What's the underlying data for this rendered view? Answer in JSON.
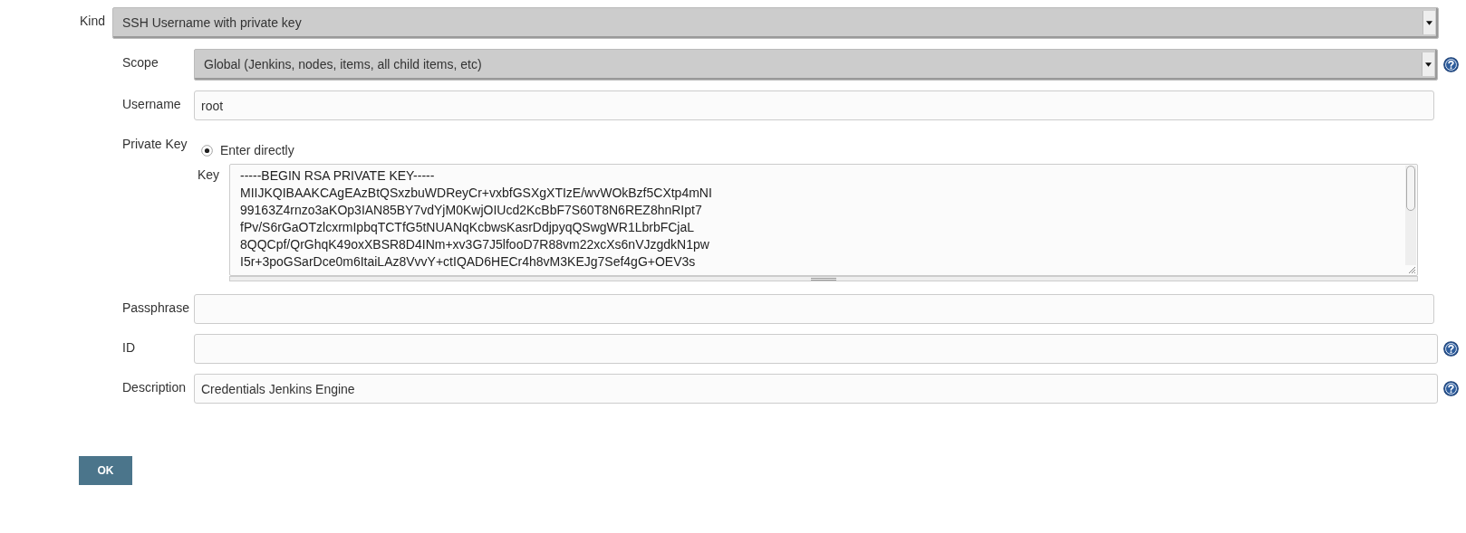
{
  "kind": {
    "label": "Kind",
    "value": "SSH Username with private key"
  },
  "fields": [
    {
      "kind": "select",
      "label": "Scope",
      "value": "Global (Jenkins, nodes, items, all child items, etc)",
      "help": true
    },
    {
      "kind": "text",
      "label": "Username",
      "value": "root",
      "help": false
    },
    {
      "kind": "private_key",
      "label": "Private Key",
      "options": [
        {
          "label": "Enter directly",
          "selected": true
        }
      ],
      "key_label": "Key",
      "key_lines": [
        "-----BEGIN RSA PRIVATE KEY-----",
        "MIIJKQIBAAKCAgEAzBtQSxzbuWDReyCr+vxbfGSXgXTIzE/wvWOkBzf5CXtp4mNI",
        "99163Z4rnzo3aKOp3IAN85BY7vdYjM0KwjOIUcd2KcBbF7S60T8N6REZ8hnRIpt7",
        "fPv/S6rGaOTzlcxrmIpbqTCTfG5tNUANqKcbwsKasrDdjpyqQSwgWR1LbrbFCjaL",
        "8QQCpf/QrGhqK49oxXBSR8D4INm+xv3G7J5lfooD7R88vm22xcXs6nVJzgdkN1pw",
        "I5r+3poGSarDce0m6ItaiLAz8VvvY+ctIQAD6HECr4h8vM3KEJg7Sef4gG+OEV3s"
      ]
    },
    {
      "kind": "text",
      "label": "Passphrase",
      "help": false
    },
    {
      "kind": "text",
      "label": "ID",
      "help": true
    },
    {
      "kind": "text",
      "label": "Description",
      "value": "Credentials Jenkins Engine",
      "help": true
    }
  ],
  "buttons": [
    {
      "label": "OK"
    }
  ]
}
